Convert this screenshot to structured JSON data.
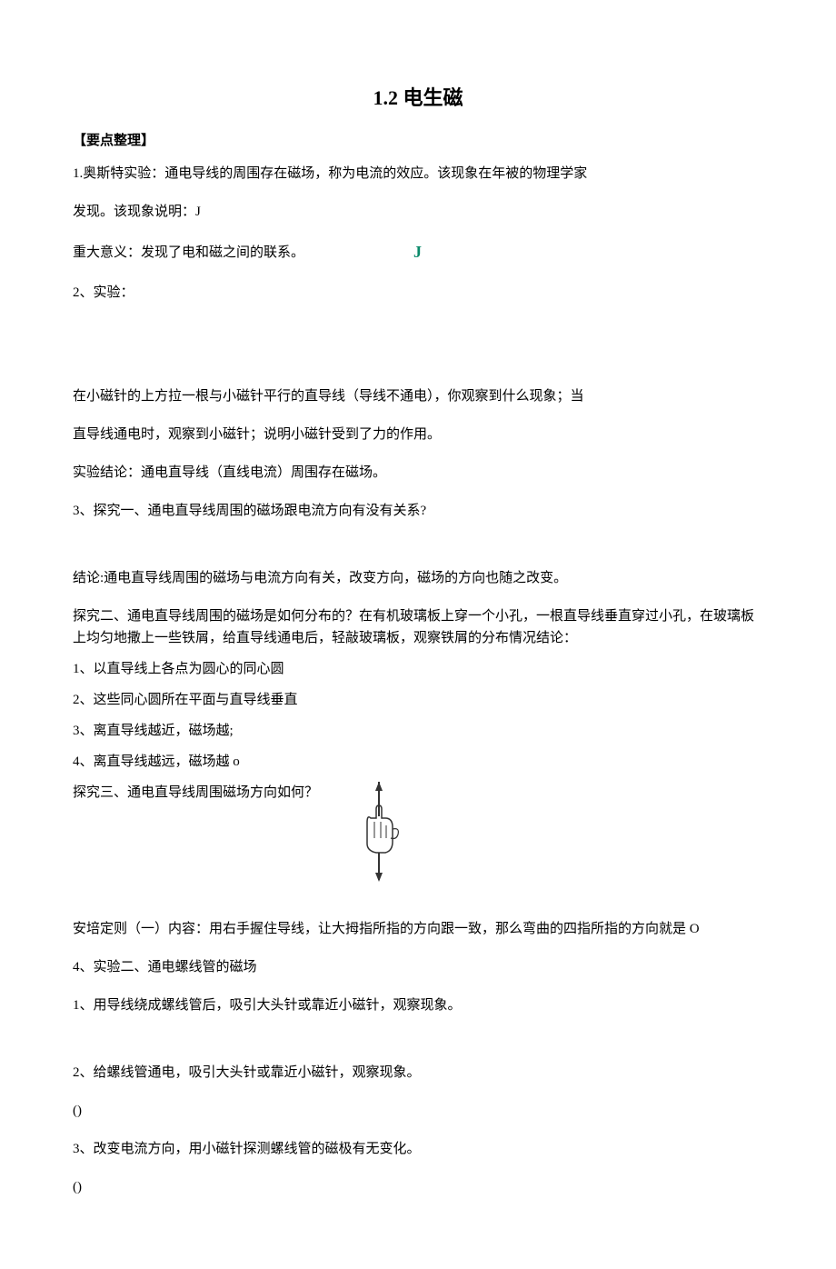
{
  "title": "1.2 电生磁",
  "header": "【要点整理】",
  "p1": "1.奥斯特实验：通电导线的周围存在磁场，称为电流的效应。该现象在年被的物理学家",
  "p2": "发现。该现象说明：J",
  "p3": "重大意义：发现了电和磁之间的联系。",
  "j": "J",
  "p4": "2、实验：",
  "p5": "在小磁针的上方拉一根与小磁针平行的直导线（导线不通电），你观察到什么现象；当",
  "p6": "直导线通电时，观察到小磁针；说明小磁针受到了力的作用。",
  "p7": "实验结论：通电直导线（直线电流）周围存在磁场。",
  "p8": "3、探究一、通电直导线周围的磁场跟电流方向有没有关系?",
  "p9": "结论:通电直导线周围的磁场与电流方向有关，改变方向，磁场的方向也随之改变。",
  "p10": "探究二、通电直导线周围的磁场是如何分布的？在有机玻璃板上穿一个小孔，一根直导线垂直穿过小孔，在玻璃板上均匀地撒上一些铁屑，给直导线通电后，轻敲玻璃板，观察铁屑的分布情况结论：",
  "l1": "1、以直导线上各点为圆心的同心圆",
  "l2": "2、这些同心圆所在平面与直导线垂直",
  "l3": "3、离直导线越近，磁场越;",
  "l4": "4、离直导线越远，磁场越 o",
  "p11": "探究三、通电直导线周围磁场方向如何？",
  "p12": "安培定则（一）内容：用右手握住导线，让大拇指所指的方向跟一致，那么弯曲的四指所指的方向就是 O",
  "p13": "4、实验二、通电螺线管的磁场",
  "p14": "1、用导线绕成螺线管后，吸引大头针或靠近小磁针，观察现象。",
  "p15": "2、给螺线管通电，吸引大头针或靠近小磁针，观察现象。",
  "paren1": "()",
  "p16": "3、改变电流方向，用小磁针探测螺线管的磁极有无变化。",
  "paren2": "()"
}
